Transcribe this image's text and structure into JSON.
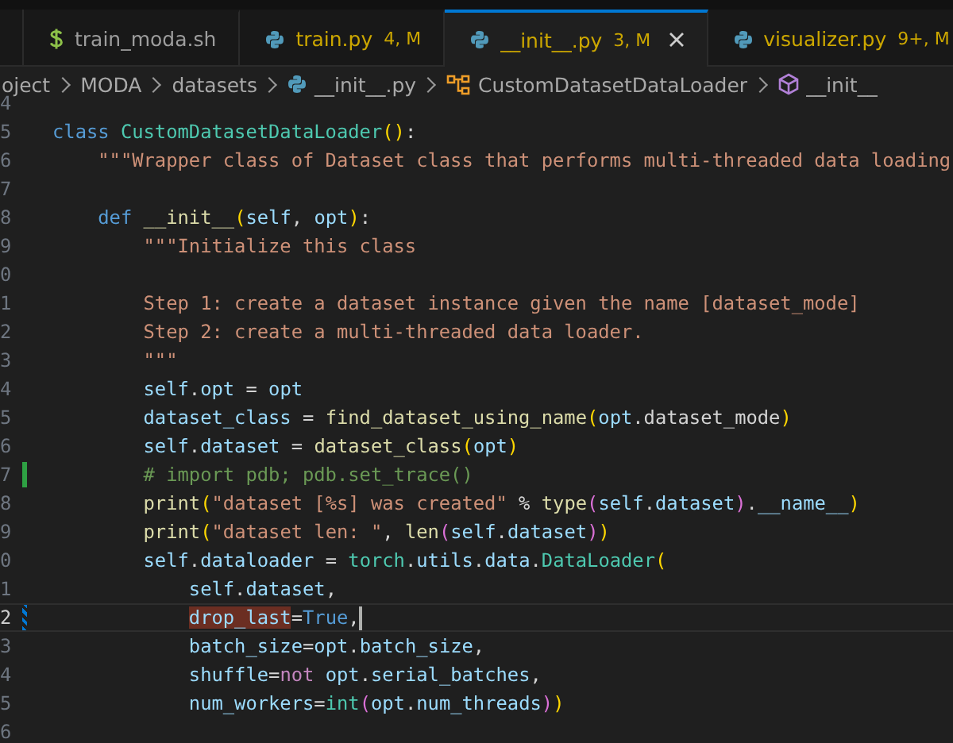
{
  "tabs": [
    {
      "label": "train_moda.sh",
      "kind": "shell",
      "modified": false,
      "selected": false
    },
    {
      "label": "train.py",
      "kind": "python",
      "badge": "4, M",
      "modified": true,
      "selected": false
    },
    {
      "label": "__init__.py",
      "kind": "python",
      "badge": "3, M",
      "modified": true,
      "selected": true
    },
    {
      "label": "visualizer.py",
      "kind": "python",
      "badge": "9+, M",
      "modified": true,
      "selected": false
    }
  ],
  "breadcrumb": [
    {
      "label": "oject",
      "kind": "folder"
    },
    {
      "label": "MODA",
      "kind": "folder"
    },
    {
      "label": "datasets",
      "kind": "folder"
    },
    {
      "label": "__init__.py",
      "kind": "python"
    },
    {
      "label": "CustomDatasetDataLoader",
      "kind": "class"
    },
    {
      "label": "__init__",
      "kind": "method"
    }
  ],
  "lines": [
    {
      "number": "4",
      "added": false,
      "modified": false,
      "current": false
    },
    {
      "number": "5",
      "added": false,
      "modified": false,
      "current": false,
      "tokens": [
        {
          "kind": "keyword",
          "text": "class "
        },
        {
          "kind": "type",
          "text": "CustomDatasetDataLoader"
        },
        {
          "kind": "bracket",
          "text": "()"
        },
        {
          "kind": "plain",
          "text": ":"
        }
      ]
    },
    {
      "number": "6",
      "added": false,
      "modified": false,
      "current": false,
      "tokens": [
        {
          "kind": "string",
          "text": "    \"\"\"Wrapper class of Dataset class that performs multi-threaded data loading"
        }
      ]
    },
    {
      "number": "7",
      "added": false,
      "modified": false,
      "current": false
    },
    {
      "number": "8",
      "added": false,
      "modified": false,
      "current": false,
      "tokens": [
        {
          "kind": "keyword",
          "text": "    def "
        },
        {
          "kind": "function",
          "text": "__init__"
        },
        {
          "kind": "bracket",
          "text": "("
        },
        {
          "kind": "variable",
          "text": "self"
        },
        {
          "kind": "plain",
          "text": ", "
        },
        {
          "kind": "variable",
          "text": "opt"
        },
        {
          "kind": "bracket",
          "text": ")"
        },
        {
          "kind": "plain",
          "text": ":"
        }
      ]
    },
    {
      "number": "9",
      "added": false,
      "modified": false,
      "current": false,
      "tokens": [
        {
          "kind": "string",
          "text": "        \"\"\"Initialize this class"
        }
      ]
    },
    {
      "number": "0",
      "added": false,
      "modified": false,
      "current": false
    },
    {
      "number": "1",
      "added": false,
      "modified": false,
      "current": false,
      "tokens": [
        {
          "kind": "string",
          "text": "        Step 1: create a dataset instance given the name [dataset_mode]"
        }
      ]
    },
    {
      "number": "2",
      "added": false,
      "modified": false,
      "current": false,
      "tokens": [
        {
          "kind": "string",
          "text": "        Step 2: create a multi-threaded data loader."
        }
      ]
    },
    {
      "number": "3",
      "added": false,
      "modified": false,
      "current": false,
      "tokens": [
        {
          "kind": "string",
          "text": "        \"\"\""
        }
      ]
    },
    {
      "number": "4",
      "added": false,
      "modified": false,
      "current": false,
      "tokens": [
        {
          "kind": "variable",
          "text": "        self"
        },
        {
          "kind": "plain",
          "text": "."
        },
        {
          "kind": "variable",
          "text": "opt"
        },
        {
          "kind": "plain",
          "text": " = "
        },
        {
          "kind": "variable",
          "text": "opt"
        }
      ]
    },
    {
      "number": "5",
      "added": false,
      "modified": false,
      "current": false,
      "tokens": [
        {
          "kind": "variable",
          "text": "        dataset_class"
        },
        {
          "kind": "plain",
          "text": " = "
        },
        {
          "kind": "function",
          "text": "find_dataset_using_name"
        },
        {
          "kind": "bracket",
          "text": "("
        },
        {
          "kind": "variable",
          "text": "opt"
        },
        {
          "kind": "plain",
          "text": ".dataset_mode"
        },
        {
          "kind": "bracket",
          "text": ")"
        }
      ]
    },
    {
      "number": "6",
      "added": false,
      "modified": false,
      "current": false,
      "tokens": [
        {
          "kind": "variable",
          "text": "        self"
        },
        {
          "kind": "plain",
          "text": "."
        },
        {
          "kind": "variable",
          "text": "dataset"
        },
        {
          "kind": "plain",
          "text": " = "
        },
        {
          "kind": "function",
          "text": "dataset_class"
        },
        {
          "kind": "bracket",
          "text": "("
        },
        {
          "kind": "variable",
          "text": "opt"
        },
        {
          "kind": "bracket",
          "text": ")"
        }
      ]
    },
    {
      "number": "7",
      "added": true,
      "modified": false,
      "current": false,
      "tokens": [
        {
          "kind": "comment",
          "text": "        # import pdb; pdb.set_trace()"
        }
      ]
    },
    {
      "number": "8",
      "added": false,
      "modified": false,
      "current": false,
      "tokens": [
        {
          "kind": "function",
          "text": "        print"
        },
        {
          "kind": "bracket",
          "text": "("
        },
        {
          "kind": "string",
          "text": "\"dataset [%s] was created\""
        },
        {
          "kind": "plain",
          "text": " % "
        },
        {
          "kind": "function",
          "text": "type"
        },
        {
          "kind": "bracket2",
          "text": "("
        },
        {
          "kind": "variable",
          "text": "self"
        },
        {
          "kind": "plain",
          "text": "."
        },
        {
          "kind": "variable",
          "text": "dataset"
        },
        {
          "kind": "bracket2",
          "text": ")"
        },
        {
          "kind": "plain",
          "text": "."
        },
        {
          "kind": "variable",
          "text": "__name__"
        },
        {
          "kind": "bracket",
          "text": ")"
        }
      ]
    },
    {
      "number": "9",
      "added": false,
      "modified": false,
      "current": false,
      "tokens": [
        {
          "kind": "function",
          "text": "        print"
        },
        {
          "kind": "bracket",
          "text": "("
        },
        {
          "kind": "string",
          "text": "\"dataset len: \""
        },
        {
          "kind": "plain",
          "text": ", "
        },
        {
          "kind": "function",
          "text": "len"
        },
        {
          "kind": "bracket2",
          "text": "("
        },
        {
          "kind": "variable",
          "text": "self"
        },
        {
          "kind": "plain",
          "text": "."
        },
        {
          "kind": "variable",
          "text": "dataset"
        },
        {
          "kind": "bracket2",
          "text": ")"
        },
        {
          "kind": "bracket",
          "text": ")"
        }
      ]
    },
    {
      "number": "0",
      "added": false,
      "modified": false,
      "current": false,
      "tokens": [
        {
          "kind": "variable",
          "text": "        self"
        },
        {
          "kind": "plain",
          "text": "."
        },
        {
          "kind": "variable",
          "text": "dataloader"
        },
        {
          "kind": "plain",
          "text": " = "
        },
        {
          "kind": "type",
          "text": "torch"
        },
        {
          "kind": "plain",
          "text": "."
        },
        {
          "kind": "variable",
          "text": "utils"
        },
        {
          "kind": "plain",
          "text": "."
        },
        {
          "kind": "variable",
          "text": "data"
        },
        {
          "kind": "plain",
          "text": "."
        },
        {
          "kind": "type",
          "text": "DataLoader"
        },
        {
          "kind": "bracket",
          "text": "("
        }
      ]
    },
    {
      "number": "1",
      "added": false,
      "modified": false,
      "current": false,
      "tokens": [
        {
          "kind": "variable",
          "text": "            self"
        },
        {
          "kind": "plain",
          "text": "."
        },
        {
          "kind": "variable",
          "text": "dataset"
        },
        {
          "kind": "plain",
          "text": ","
        }
      ]
    },
    {
      "number": "2",
      "added": false,
      "modified": true,
      "current": true,
      "tokens": [
        {
          "kind": "match",
          "text": "            drop_last"
        },
        {
          "kind": "plain",
          "text": "="
        },
        {
          "kind": "keyword",
          "text": "True"
        },
        {
          "kind": "plain",
          "text": ","
        }
      ]
    },
    {
      "number": "3",
      "added": false,
      "modified": false,
      "current": false,
      "tokens": [
        {
          "kind": "variable",
          "text": "            batch_size"
        },
        {
          "kind": "plain",
          "text": "="
        },
        {
          "kind": "variable",
          "text": "opt"
        },
        {
          "kind": "plain",
          "text": "."
        },
        {
          "kind": "variable",
          "text": "batch_size"
        },
        {
          "kind": "plain",
          "text": ","
        }
      ]
    },
    {
      "number": "4",
      "added": false,
      "modified": false,
      "current": false,
      "tokens": [
        {
          "kind": "variable",
          "text": "            shuffle"
        },
        {
          "kind": "plain",
          "text": "="
        },
        {
          "kind": "control",
          "text": "not "
        },
        {
          "kind": "variable",
          "text": "opt"
        },
        {
          "kind": "plain",
          "text": "."
        },
        {
          "kind": "variable",
          "text": "serial_batches"
        },
        {
          "kind": "plain",
          "text": ","
        }
      ]
    },
    {
      "number": "5",
      "added": false,
      "modified": false,
      "current": false,
      "tokens": [
        {
          "kind": "variable",
          "text": "            num_workers"
        },
        {
          "kind": "plain",
          "text": "="
        },
        {
          "kind": "type",
          "text": "int"
        },
        {
          "kind": "bracket2",
          "text": "("
        },
        {
          "kind": "variable",
          "text": "opt"
        },
        {
          "kind": "plain",
          "text": "."
        },
        {
          "kind": "variable",
          "text": "num_threads"
        },
        {
          "kind": "bracket2",
          "text": ")"
        },
        {
          "kind": "bracket",
          "text": ")"
        }
      ]
    },
    {
      "number": "6",
      "added": false,
      "modified": false,
      "current": false
    }
  ]
}
